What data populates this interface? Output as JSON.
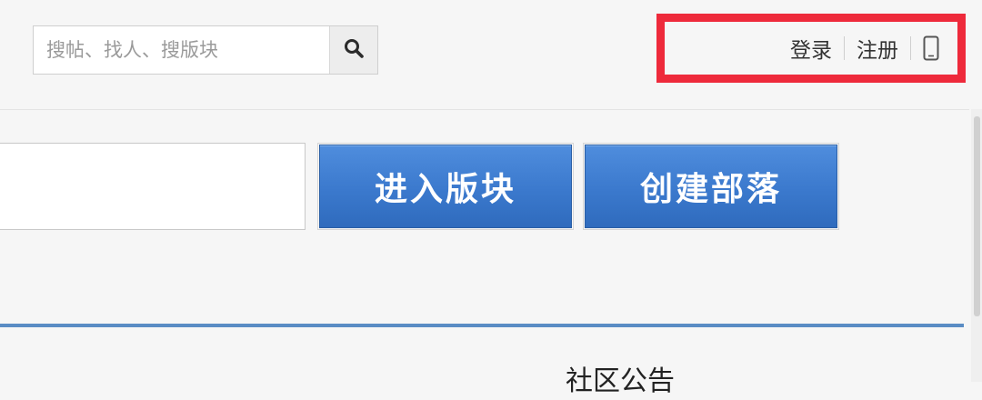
{
  "search": {
    "placeholder": "搜帖、找人、搜版块",
    "button_icon": "search-icon"
  },
  "user_nav": {
    "login_label": "登录",
    "register_label": "注册",
    "mobile_icon": "mobile-phone-icon"
  },
  "forum_actions": {
    "enter_forum_label": "进入版块",
    "create_tribe_label": "创建部落"
  },
  "section": {
    "announcement_title": "社区公告"
  },
  "colors": {
    "highlight_border": "#ee2a3b",
    "button_blue": "#3b79cd",
    "rule_blue": "#5a8cc4"
  }
}
